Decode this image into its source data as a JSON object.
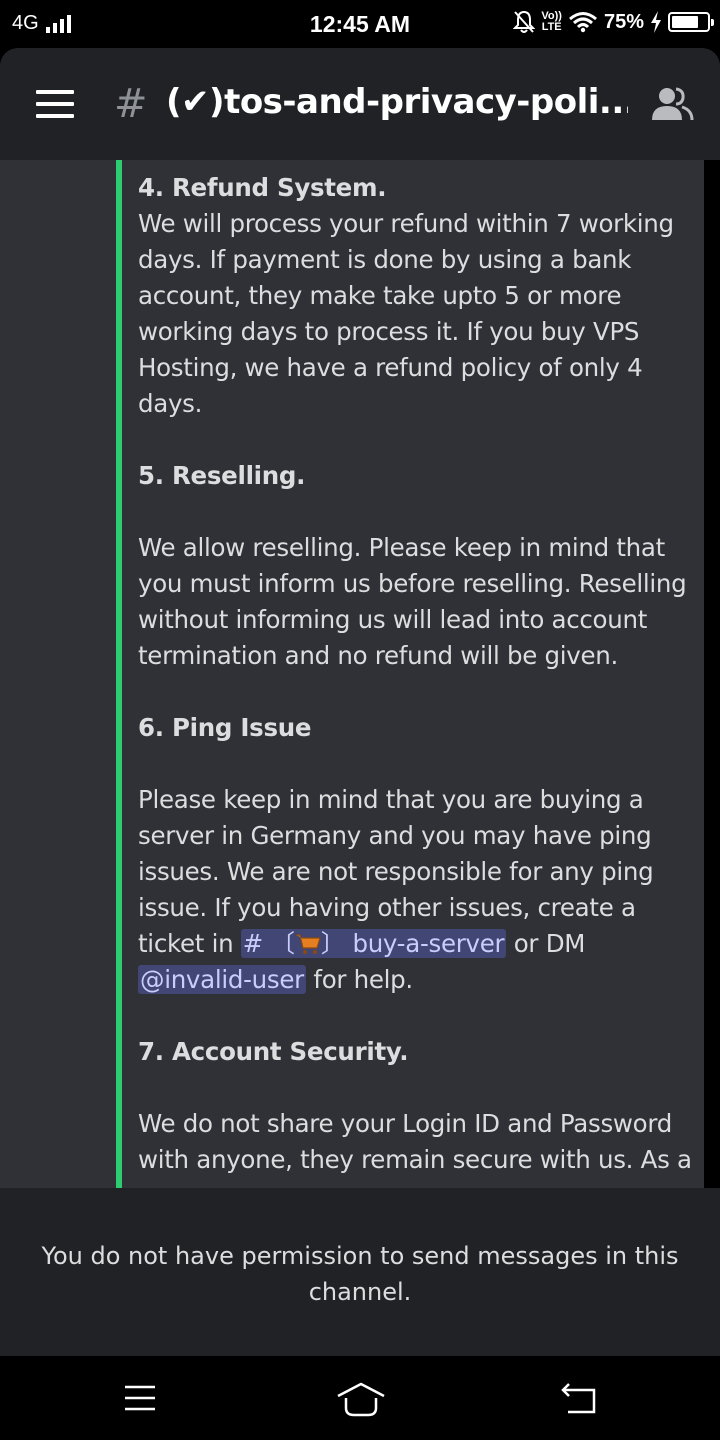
{
  "status_bar": {
    "network": "4G",
    "time": "12:45 AM",
    "volte_top": "Vo))",
    "volte_bottom": "LTE",
    "battery": "75%",
    "battery_level": 0.75
  },
  "header": {
    "hash": "#",
    "channel_name": "(✔)tos-and-privacy-poli..."
  },
  "embed": {
    "accent_color": "#2ecc71",
    "s4_title": "4. Refund System.",
    "s4_body": "We will process your refund within 7 working days. If payment is done by using a bank account, they make take upto 5 or more working days to process it. If you buy VPS Hosting, we have a refund policy of only 4 days.",
    "s5_title": "5. Reselling.",
    "s5_body": "We allow reselling. Please keep in mind that you must inform us before reselling. Reselling without informing us will lead into account termination and no refund will be given.",
    "s6_title": "6. Ping Issue",
    "s6_body_a": "Please keep in mind that you are buying a server in Germany and you may have ping issues. We are not responsible for any ping issue. If you having other issues, create a ticket in ",
    "s6_channel_hash": "#",
    "s6_channel_bracket_open": "〔",
    "s6_channel_bracket_close": "〕",
    "s6_channel_name": "buy-a-server",
    "s6_body_b": " or DM ",
    "s6_user_mention": "@invalid-user",
    "s6_body_c": " for help.",
    "s7_title": "7. Account Security.",
    "s7_body": "We do not share your Login ID and Password with anyone, they remain secure with us. As a"
  },
  "composer": {
    "notice": "You do not have permission to send messages in this channel."
  },
  "icons": {
    "menu": "hamburger-icon",
    "members": "members-icon",
    "cart": "shopping-cart-icon",
    "nav_recents": "recents-icon",
    "nav_home": "home-icon",
    "nav_back": "back-icon"
  }
}
